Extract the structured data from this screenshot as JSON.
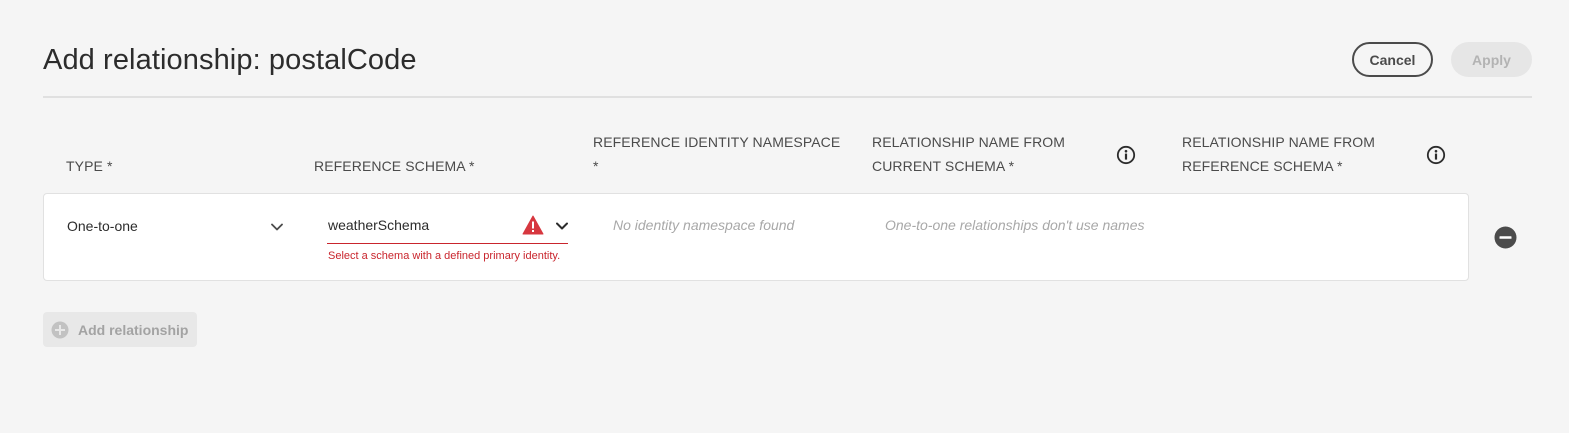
{
  "header": {
    "title": "Add relationship: postalCode",
    "cancel_label": "Cancel",
    "apply_label": "Apply"
  },
  "columns": {
    "type": "TYPE *",
    "reference_schema": "REFERENCE SCHEMA *",
    "ref_identity_ns_line1": "REFERENCE IDENTITY NAMESPACE",
    "ref_identity_ns_line2": "*",
    "rel_name_current_line1": "RELATIONSHIP NAME FROM",
    "rel_name_current_line2": "CURRENT SCHEMA *",
    "rel_name_reference_line1": "RELATIONSHIP NAME FROM",
    "rel_name_reference_line2": "REFERENCE SCHEMA *"
  },
  "row": {
    "type_value": "One-to-one",
    "schema_value": "weatherSchema",
    "schema_error": "Select a schema with a defined primary identity.",
    "namespace_placeholder": "No identity namespace found",
    "names_placeholder": "One-to-one relationships don't use names"
  },
  "footer": {
    "add_relationship_label": "Add relationship"
  },
  "icons": {
    "info": "info-icon",
    "chevron": "chevron-down-icon",
    "alert": "alert-icon",
    "remove": "remove-circle-icon",
    "add": "add-circle-icon"
  },
  "colors": {
    "error": "#c9252d",
    "background": "#f5f5f5"
  }
}
